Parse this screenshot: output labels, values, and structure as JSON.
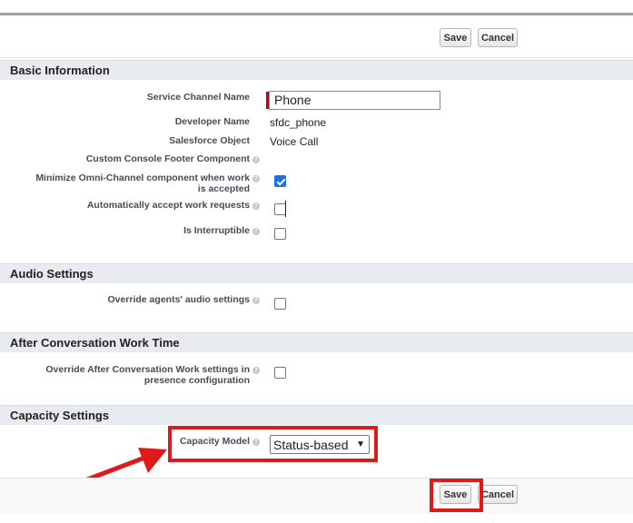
{
  "toolbar": {
    "save_label": "Save",
    "cancel_label": "Cancel"
  },
  "sections": {
    "basic": "Basic Information",
    "audio": "Audio Settings",
    "acw": "After Conversation Work Time",
    "capacity": "Capacity Settings"
  },
  "fields": {
    "service_channel_name": {
      "label": "Service Channel Name",
      "value": "Phone"
    },
    "developer_name": {
      "label": "Developer Name",
      "value": "sfdc_phone"
    },
    "salesforce_object": {
      "label": "Salesforce Object",
      "value": "Voice Call"
    },
    "custom_footer": {
      "label": "Custom Console Footer Component"
    },
    "minimize_omni": {
      "label_line1": "Minimize Omni-Channel component when work",
      "label_line2": "is accepted",
      "checked": true
    },
    "auto_accept": {
      "label": "Automatically accept work requests",
      "checked": false
    },
    "interruptible": {
      "label": "Is Interruptible",
      "checked": false
    },
    "override_audio": {
      "label": "Override agents' audio settings",
      "checked": false
    },
    "override_acw": {
      "label_line1": "Override After Conversation Work settings in",
      "label_line2": "presence configuration",
      "checked": false
    },
    "capacity_model": {
      "label": "Capacity Model",
      "value": "Status-based"
    }
  },
  "icons": {
    "help": "help-icon",
    "checkbox_check": "check-icon",
    "dropdown": "chevron-down-icon"
  },
  "colors": {
    "highlight": "#e0191b",
    "section_bg": "#e8ebf0",
    "checkbox_checked": "#1a73e8"
  }
}
